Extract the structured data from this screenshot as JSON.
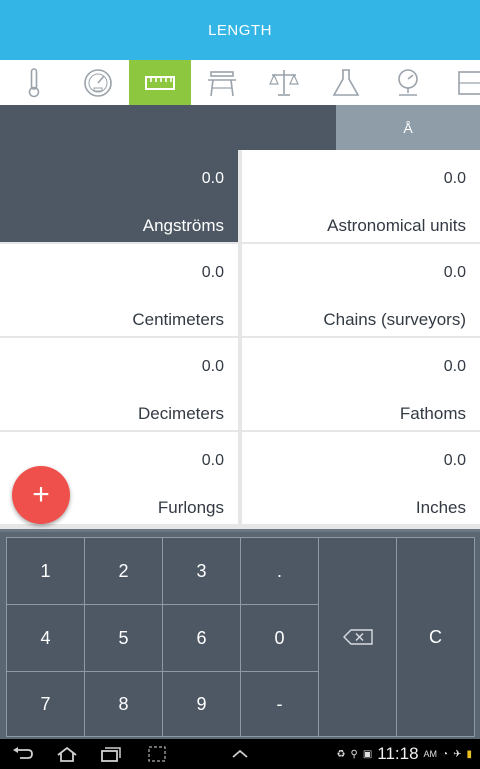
{
  "header": {
    "title": "LENGTH"
  },
  "tabs": [
    {
      "icon": "thermometer-icon",
      "active": false
    },
    {
      "icon": "speedometer-icon",
      "active": false
    },
    {
      "icon": "ruler-icon",
      "active": true
    },
    {
      "icon": "table-area-icon",
      "active": false
    },
    {
      "icon": "scale-balance-icon",
      "active": false
    },
    {
      "icon": "flask-icon",
      "active": false
    },
    {
      "icon": "pressure-gauge-icon",
      "active": false
    },
    {
      "icon": "more-categories-icon",
      "active": false
    }
  ],
  "input": {
    "value": "",
    "unit_symbol": "Å"
  },
  "units": [
    {
      "value": "0.0",
      "name": "Angströms",
      "selected": true
    },
    {
      "value": "0.0",
      "name": "Astronomical units",
      "selected": false
    },
    {
      "value": "0.0",
      "name": "Centimeters",
      "selected": false
    },
    {
      "value": "0.0",
      "name": "Chains (surveyors)",
      "selected": false
    },
    {
      "value": "0.0",
      "name": "Decimeters",
      "selected": false
    },
    {
      "value": "0.0",
      "name": "Fathoms",
      "selected": false
    },
    {
      "value": "0.0",
      "name": "Furlongs",
      "selected": false
    },
    {
      "value": "0.0",
      "name": "Inches",
      "selected": false
    }
  ],
  "fab": {
    "label": "+"
  },
  "keypad": {
    "keys": [
      "1",
      "2",
      "3",
      ".",
      "4",
      "5",
      "6",
      "0",
      "7",
      "8",
      "9",
      "-"
    ],
    "backspace_icon": "backspace-icon",
    "clear": "C"
  },
  "system_bar": {
    "time": "11:18",
    "ampm": "AM",
    "nav_icons": [
      "back-icon",
      "home-icon",
      "recent-apps-icon",
      "screenshot-icon",
      "chevron-up-icon"
    ],
    "status_icons": [
      "recycle-icon",
      "usb-icon",
      "notification-icon",
      "wifi-icon",
      "airplane-icon",
      "battery-icon"
    ]
  },
  "colors": {
    "accent": "#33b5e5",
    "active_tab": "#8dc63f",
    "dark_slate": "#4e5865",
    "fab": "#f0504c"
  }
}
